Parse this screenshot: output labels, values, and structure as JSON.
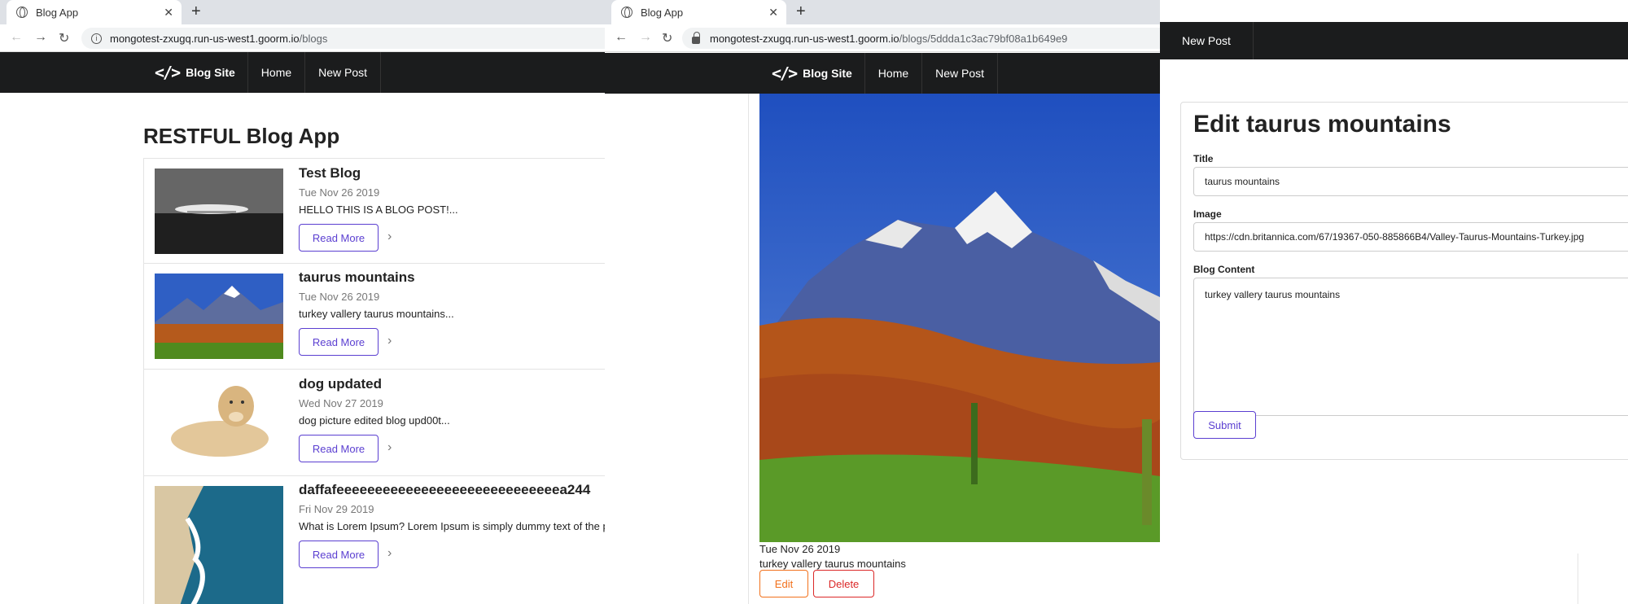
{
  "tab1": {
    "title": "Blog App",
    "url_host": "mongotest-zxugq.run-us-west1.goorm.io",
    "url_path": "/blogs"
  },
  "tab2": {
    "title": "Blog App",
    "url_host": "mongotest-zxugq.run-us-west1.goorm.io",
    "url_path": "/blogs/5ddda1c3ac79bf08a1b649e9"
  },
  "navbar": {
    "brand": "Blog Site",
    "home": "Home",
    "new_post": "New Post"
  },
  "index": {
    "heading": "RESTFUL Blog App",
    "read_more": "Read More",
    "posts": [
      {
        "title": "Test Blog",
        "date": "Tue Nov 26 2019",
        "excerpt": "HELLO THIS IS A BLOG POST!..."
      },
      {
        "title": "taurus mountains",
        "date": "Tue Nov 26 2019",
        "excerpt": "turkey vallery taurus mountains..."
      },
      {
        "title": "dog updated",
        "date": "Wed Nov 27 2019",
        "excerpt": "dog picture edited blog upd00t..."
      },
      {
        "title": "daffafeeeeeeeeeeeeeeeeeeeeeeeeeeeeea244",
        "date": "Fri Nov 29 2019",
        "excerpt": "What is Lorem Ipsum? Lorem Ipsum is simply dummy text of the print"
      }
    ]
  },
  "show": {
    "date": "Tue Nov 26 2019",
    "body": "turkey vallery taurus mountains",
    "edit": "Edit",
    "delete": "Delete"
  },
  "edit_form": {
    "heading": "Edit taurus mountains",
    "title_label": "Title",
    "title_value": "taurus mountains",
    "image_label": "Image",
    "image_value": "https://cdn.britannica.com/67/19367-050-885866B4/Valley-Taurus-Mountains-Turkey.jpg",
    "content_label": "Blog Content",
    "content_value": "turkey vallery taurus mountains",
    "submit": "Submit"
  },
  "colors": {
    "navbar": "#1b1c1d",
    "violet": "#5b3fd1",
    "orange": "#f2711c",
    "red": "#db2828"
  }
}
